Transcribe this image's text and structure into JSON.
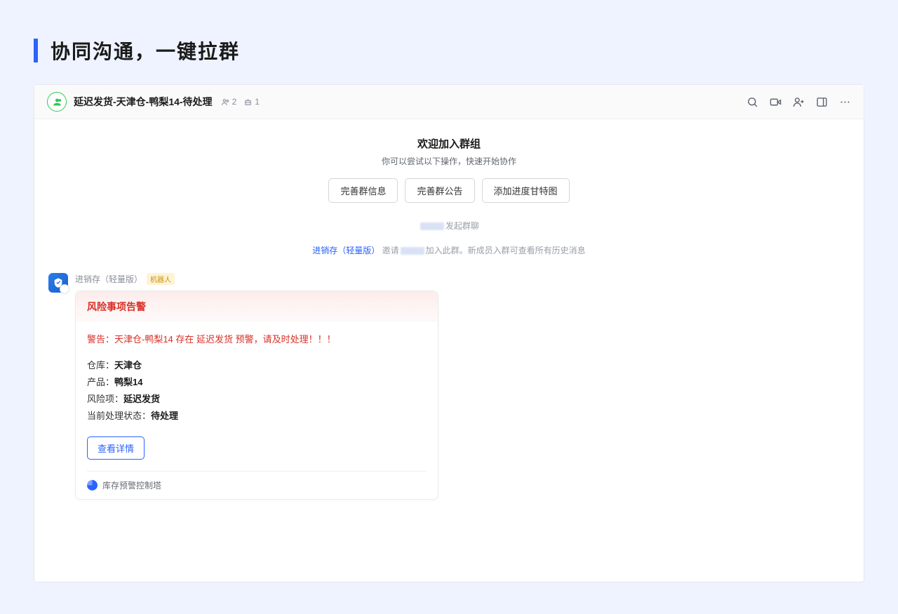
{
  "page": {
    "title": "协同沟通，一键拉群"
  },
  "header": {
    "group_name": "延迟发货-天津仓-鸭梨14-待处理",
    "members_count": "2",
    "bots_count": "1"
  },
  "welcome": {
    "title": "欢迎加入群组",
    "subtitle": "你可以尝试以下操作，快速开始协作",
    "btn_info": "完善群信息",
    "btn_announce": "完善群公告",
    "btn_gantt": "添加进度甘特图"
  },
  "system": {
    "created_suffix": "发起群聊",
    "invite_app": "进销存（轻量版）",
    "invite_prefix": "邀请",
    "invite_suffix": "加入此群。新成员入群可查看所有历史消息"
  },
  "message": {
    "sender": "进销存（轻量版）",
    "bot_tag": "机器人"
  },
  "alert": {
    "card_title": "风险事项告警",
    "warning_text": "警告：天津仓-鸭梨14 存在 延迟发货 预警，请及时处理！！！",
    "warehouse_label": "仓库：",
    "warehouse_value": "天津仓",
    "product_label": "产品：",
    "product_value": "鸭梨14",
    "risk_label": "风险项：",
    "risk_value": "延迟发货",
    "status_label": "当前处理状态：",
    "status_value": "待处理",
    "view_btn": "查看详情",
    "footer_text": "库存预警控制塔"
  }
}
